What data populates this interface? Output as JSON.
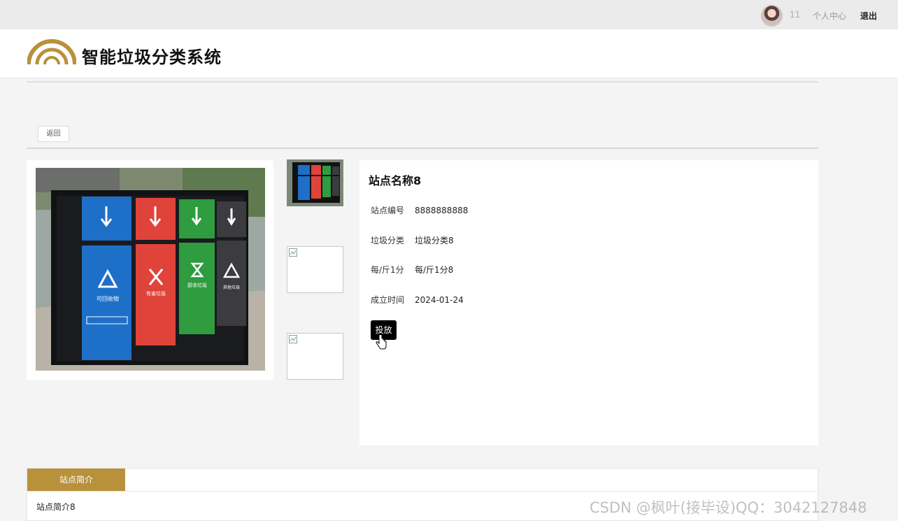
{
  "topbar": {
    "username": "11",
    "user_center": "个人中心",
    "logout": "退出"
  },
  "header": {
    "site_title": "智能垃圾分类系统",
    "logo_color": "#b8913a"
  },
  "toolbar": {
    "back_label": "返回"
  },
  "station": {
    "name": "站点名称8",
    "fields": [
      {
        "label": "站点编号",
        "value": "8888888888"
      },
      {
        "label": "垃圾分类",
        "value": "垃圾分类8"
      },
      {
        "label": "每/斤1分",
        "value": "每/斤1分8"
      },
      {
        "label": "成立时间",
        "value": "2024-01-24"
      }
    ],
    "action_label": "投放"
  },
  "bin_labels": [
    "可回收物",
    "有害垃圾",
    "厨余垃圾",
    "其他垃圾"
  ],
  "description": {
    "tab_label": "站点简介",
    "text": "站点简介8"
  },
  "watermark": "CSDN @枫叶(接毕设)QQ：3042127848",
  "colors": {
    "accent": "#b8913a",
    "recyclable": "#1e6fc8",
    "hazardous": "#e0433a",
    "kitchen": "#2e9c3f",
    "other": "#3c3c40"
  }
}
